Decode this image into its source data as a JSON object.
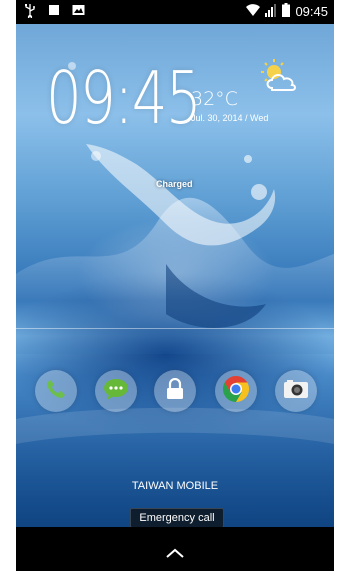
{
  "status_bar": {
    "time": "09:45",
    "left_icons": [
      "usb-icon",
      "square-icon",
      "gallery-icon"
    ],
    "right_icons": [
      "wifi-icon",
      "signal-icon",
      "battery-icon"
    ]
  },
  "lock_screen": {
    "clock": "09:45",
    "temperature": "32°C",
    "date": "Jul. 30, 2014 / Wed",
    "weather_icon": "sun-cloud-icon",
    "charge_status": "Charged",
    "carrier": "TAIWAN MOBILE",
    "emergency_call_label": "Emergency call",
    "shortcuts": [
      {
        "name": "phone",
        "icon": "phone-icon",
        "color": "#6bbf4a"
      },
      {
        "name": "messaging",
        "icon": "chat-icon",
        "color": "#66b838"
      },
      {
        "name": "unlock",
        "icon": "lock-icon",
        "color": "#ffffff"
      },
      {
        "name": "chrome",
        "icon": "chrome-icon",
        "color": "#e34133"
      },
      {
        "name": "camera",
        "icon": "camera-icon",
        "color": "#333333"
      }
    ]
  },
  "nav_bar": {
    "icon": "chevron-up-icon"
  }
}
